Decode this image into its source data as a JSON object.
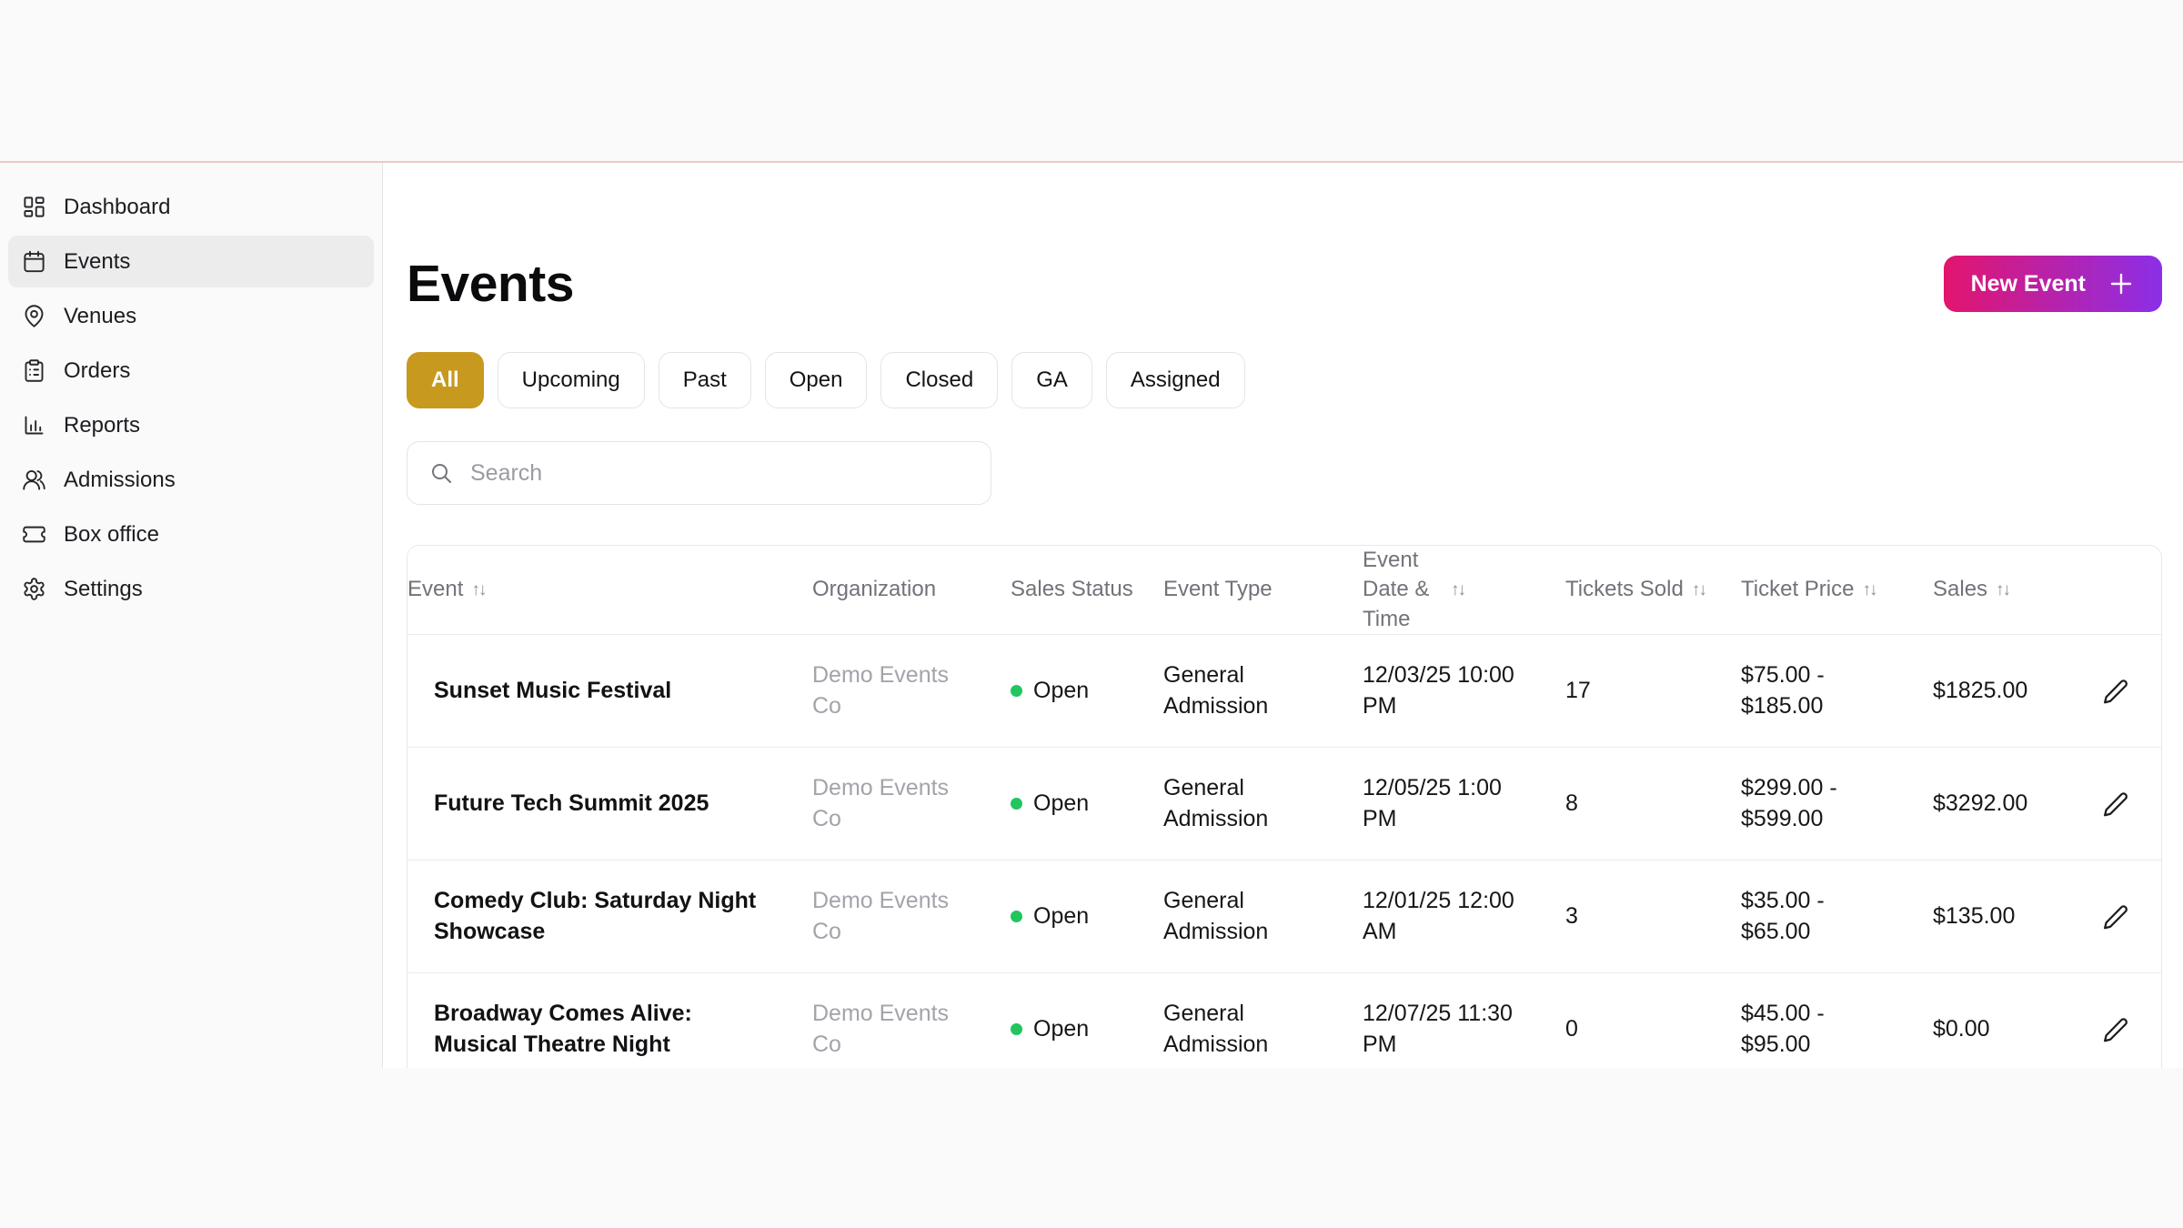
{
  "colors": {
    "accent_gold": "#C8991F",
    "new_event_gradient_start": "#E3156D",
    "new_event_gradient_end": "#8B2FE8",
    "status_open_dot": "#22C55E",
    "top_divider_pink": "#F3C7C5"
  },
  "sidebar": {
    "items": [
      {
        "label": "Dashboard",
        "icon": "dashboard-icon",
        "active": false
      },
      {
        "label": "Events",
        "icon": "calendar-icon",
        "active": true
      },
      {
        "label": "Venues",
        "icon": "map-pin-icon",
        "active": false
      },
      {
        "label": "Orders",
        "icon": "clipboard-icon",
        "active": false
      },
      {
        "label": "Reports",
        "icon": "bar-chart-icon",
        "active": false
      },
      {
        "label": "Admissions",
        "icon": "users-icon",
        "active": false
      },
      {
        "label": "Box office",
        "icon": "ticket-icon",
        "active": false
      },
      {
        "label": "Settings",
        "icon": "gear-icon",
        "active": false
      }
    ]
  },
  "header": {
    "title": "Events",
    "new_event_label": "New Event",
    "new_event_icon": "plus-icon"
  },
  "filters": {
    "chips": [
      {
        "label": "All",
        "active": true
      },
      {
        "label": "Upcoming",
        "active": false
      },
      {
        "label": "Past",
        "active": false
      },
      {
        "label": "Open",
        "active": false
      },
      {
        "label": "Closed",
        "active": false
      },
      {
        "label": "GA",
        "active": false
      },
      {
        "label": "Assigned",
        "active": false
      }
    ]
  },
  "search": {
    "placeholder": "Search",
    "icon": "search-icon"
  },
  "table": {
    "sort_glyph": "↑↓",
    "columns": [
      {
        "label": "Event",
        "sortable": true
      },
      {
        "label": "Organization",
        "sortable": false
      },
      {
        "label": "Sales Status",
        "sortable": false
      },
      {
        "label": "Event Type",
        "sortable": false
      },
      {
        "label": "Event Date & Time",
        "sortable": true
      },
      {
        "label": "Tickets Sold",
        "sortable": true
      },
      {
        "label": "Ticket Price",
        "sortable": true
      },
      {
        "label": "Sales",
        "sortable": true
      }
    ],
    "rows": [
      {
        "event": "Sunset Music Festival",
        "organization": "Demo Events Co",
        "sales_status": "Open",
        "event_type": "General Admission",
        "event_datetime": "12/03/25 10:00 PM",
        "tickets_sold": 17,
        "ticket_price": "$75.00 - $185.00",
        "sales": "$1825.00"
      },
      {
        "event": "Future Tech Summit 2025",
        "organization": "Demo Events Co",
        "sales_status": "Open",
        "event_type": "General Admission",
        "event_datetime": "12/05/25 1:00 PM",
        "tickets_sold": 8,
        "ticket_price": "$299.00 - $599.00",
        "sales": "$3292.00"
      },
      {
        "event": "Comedy Club: Saturday Night Showcase",
        "organization": "Demo Events Co",
        "sales_status": "Open",
        "event_type": "General Admission",
        "event_datetime": "12/01/25 12:00 AM",
        "tickets_sold": 3,
        "ticket_price": "$35.00 - $65.00",
        "sales": "$135.00"
      },
      {
        "event": "Broadway Comes Alive: Musical Theatre Night",
        "organization": "Demo Events Co",
        "sales_status": "Open",
        "event_type": "General Admission",
        "event_datetime": "12/07/25 11:30 PM",
        "tickets_sold": 0,
        "ticket_price": "$45.00 - $95.00",
        "sales": "$0.00"
      }
    ],
    "row_action_edit_icon": "pencil-icon"
  }
}
